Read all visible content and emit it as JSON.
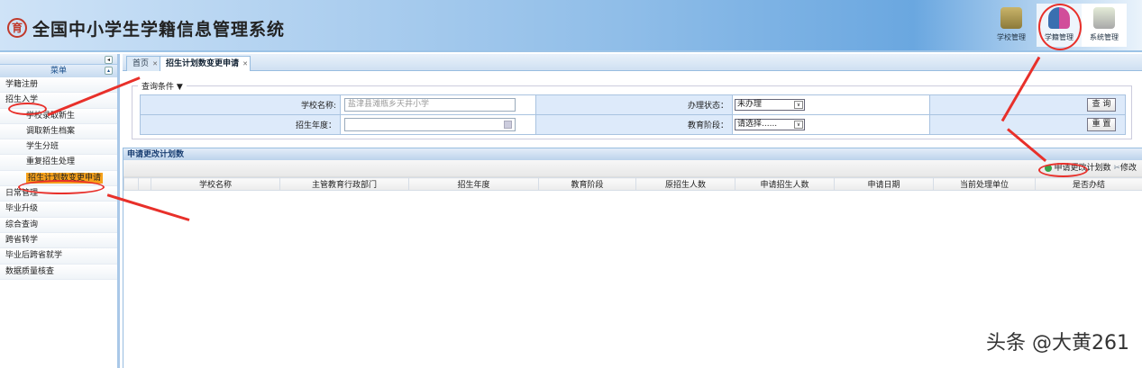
{
  "header": {
    "title": "全国中小学生学籍信息管理系统",
    "logo_text": "育",
    "nav": [
      {
        "label": "学校管理",
        "icon": "school-icon"
      },
      {
        "label": "学籍管理",
        "icon": "users-icon"
      },
      {
        "label": "系统管理",
        "icon": "settings-icon"
      }
    ]
  },
  "sidebar": {
    "menu_title": "菜单",
    "items": [
      {
        "label": "学籍注册",
        "sub": false
      },
      {
        "label": "招生入学",
        "sub": false
      },
      {
        "label": "学校录取新生",
        "sub": true
      },
      {
        "label": "调取新生档案",
        "sub": true
      },
      {
        "label": "学生分班",
        "sub": true
      },
      {
        "label": "重复招生处理",
        "sub": true
      },
      {
        "label": "招生计划数变更申请",
        "sub": true,
        "active": true
      },
      {
        "label": "日常管理",
        "sub": false
      },
      {
        "label": "毕业升级",
        "sub": false
      },
      {
        "label": "综合查询",
        "sub": false
      },
      {
        "label": "跨省转学",
        "sub": false
      },
      {
        "label": "毕业后跨省就学",
        "sub": false
      },
      {
        "label": "数据质量核查",
        "sub": false
      }
    ]
  },
  "tabs": [
    {
      "label": "首页"
    },
    {
      "label": "招生计划数变更申请"
    }
  ],
  "query": {
    "legend": "查询条件 ▼",
    "school_label": "学校名称:",
    "school_value": "盐津县滩瓶乡天井小学",
    "year_label": "招生年度：",
    "year_value": "",
    "status_label": "办理状态：",
    "status_value": "未办理",
    "stage_label": "教育阶段：",
    "stage_value": "请选择......",
    "search_btn": "查 询",
    "reset_btn": "重 置"
  },
  "section": {
    "title": "申请更改计划数",
    "add_btn": "申请更改计划数",
    "edit_btn": "修改",
    "columns": [
      "学校名称",
      "主管教育行政部门",
      "招生年度",
      "教育阶段",
      "原招生人数",
      "申请招生人数",
      "申请日期",
      "当前处理单位",
      "是否办结"
    ]
  },
  "watermark": "头条 @大黄261"
}
